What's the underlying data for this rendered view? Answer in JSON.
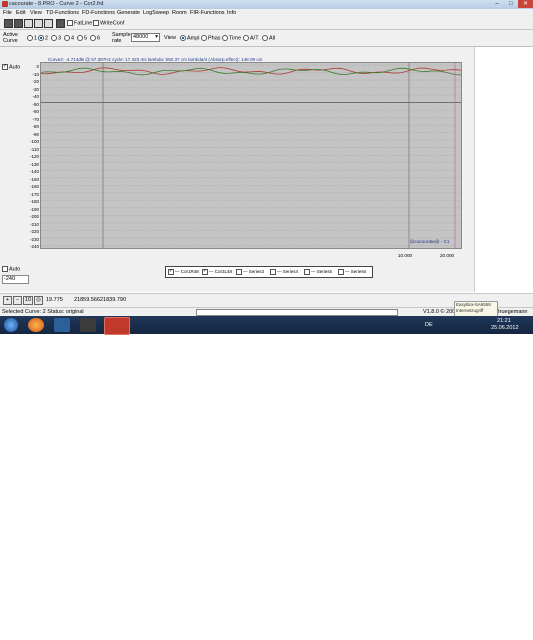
{
  "window": {
    "title": "cacourate - 8.PRO - Curve 2 - Cor2.frd",
    "min": "–",
    "max": "□",
    "close": "✕"
  },
  "menu": [
    "File",
    "Edit",
    "View",
    "TD-Functions",
    "FD-Functions",
    "Generate",
    "LogSweep",
    "Room",
    "FIR-Functions",
    "Info"
  ],
  "toolbar": {
    "fatline": "FatLine",
    "writeconf": "WriteConf"
  },
  "options": {
    "active_curve_label": "Active Curve",
    "curves": [
      "1",
      "2",
      "3",
      "4",
      "5",
      "6"
    ],
    "selected_curve": "2",
    "sample_rate_label": "Sample rate",
    "sample_rate_value": "48000",
    "view_label": "View",
    "views": [
      "Ampl",
      "Phas",
      "Time",
      "A/T",
      "All"
    ],
    "selected_view": "Ampl"
  },
  "left": {
    "auto_top": "Auto",
    "auto_bottom": "Auto",
    "bottom_value": "-240"
  },
  "plot": {
    "info": "Curve2: -4.714dB @ 57.397Hz    cycle: 17.423 ms    lambda: 592.37 cm    lambda/4 (Absorp.effect): 148.09 cm",
    "watermark": "@cacourate@ - C1",
    "y_ticks": [
      "0",
      "-10",
      "-20",
      "-30",
      "-40",
      "-50",
      "-60",
      "-70",
      "-80",
      "-90",
      "-100",
      "-110",
      "-120",
      "-130",
      "-140",
      "-150",
      "-160",
      "-170",
      "-180",
      "-190",
      "-200",
      "-210",
      "-220",
      "-230",
      "-240"
    ],
    "x_ticks": [
      "10.000",
      "20.000"
    ]
  },
  "legend": [
    {
      "label": "Cor1R48",
      "checked": true,
      "color": "#b03a2e"
    },
    {
      "label": "Cor2L48",
      "checked": true,
      "color": "#2e7d32"
    },
    {
      "label": "Series3",
      "checked": false,
      "color": "#000000"
    },
    {
      "label": "Series4",
      "checked": false,
      "color": "#000000"
    },
    {
      "label": "Series5",
      "checked": false,
      "color": "#000000"
    },
    {
      "label": "Series6",
      "checked": false,
      "color": "#000000"
    }
  ],
  "bottom": {
    "val1": "19.775",
    "val2": "21859.566",
    "val3": "21839.790",
    "zoom_in": "+",
    "zoom_out": "−",
    "ten": "10",
    "reset": "◎"
  },
  "status": {
    "left": "Selected Curve: 2   Status: original",
    "version": "V1.8.0 © 2002",
    "author": "Bruegemann"
  },
  "tooltip": {
    "line1": "EasyBox-5A6558",
    "line2": "Internetzugriff"
  },
  "taskbar": {
    "lang": "DE",
    "time": "21:21",
    "date": "25.06.2012"
  },
  "colors": {
    "curve1": "#b03a2e",
    "curve2": "#3a7d2e",
    "marker": "#d45a8a"
  }
}
